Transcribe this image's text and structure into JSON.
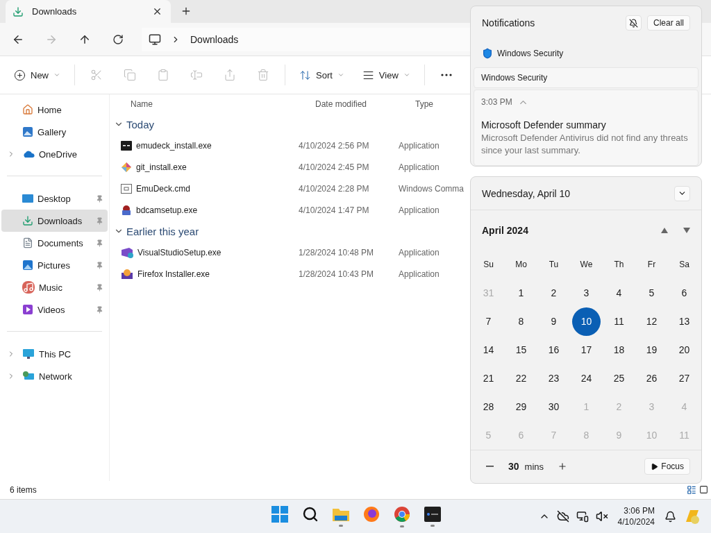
{
  "tab": {
    "title": "Downloads"
  },
  "address": {
    "crumb": "Downloads"
  },
  "toolbar": {
    "new_label": "New",
    "actions": [
      {
        "kind": "cut",
        "disabled": true
      },
      {
        "kind": "copy",
        "disabled": true
      },
      {
        "kind": "paste",
        "disabled": true
      },
      {
        "kind": "rename",
        "disabled": true
      },
      {
        "kind": "share",
        "disabled": true
      },
      {
        "kind": "delete",
        "disabled": true
      }
    ],
    "sort_label": "Sort",
    "view_label": "View"
  },
  "sidebar": {
    "groups": [
      [
        {
          "label": "Home",
          "kind": "home",
          "expandable": false,
          "pinned": false,
          "selected": false
        },
        {
          "label": "Gallery",
          "kind": "gallery",
          "expandable": false,
          "pinned": false,
          "selected": false
        },
        {
          "label": "OneDrive",
          "kind": "cloud",
          "expandable": true,
          "pinned": false,
          "selected": false
        }
      ],
      [
        {
          "label": "Desktop",
          "kind": "desktop",
          "expandable": false,
          "pinned": true,
          "selected": false
        },
        {
          "label": "Downloads",
          "kind": "download",
          "expandable": false,
          "pinned": true,
          "selected": true
        },
        {
          "label": "Documents",
          "kind": "document",
          "expandable": false,
          "pinned": true,
          "selected": false
        },
        {
          "label": "Pictures",
          "kind": "pictures",
          "expandable": false,
          "pinned": true,
          "selected": false
        },
        {
          "label": "Music",
          "kind": "music",
          "expandable": false,
          "pinned": true,
          "selected": false
        },
        {
          "label": "Videos",
          "kind": "videos",
          "expandable": false,
          "pinned": true,
          "selected": false
        }
      ],
      [
        {
          "label": "This PC",
          "kind": "pc",
          "expandable": true,
          "pinned": false,
          "selected": false
        },
        {
          "label": "Network",
          "kind": "network",
          "expandable": true,
          "pinned": false,
          "selected": false
        }
      ]
    ]
  },
  "columns": [
    "Name",
    "Date modified",
    "Type"
  ],
  "file_groups": [
    {
      "title": "Today",
      "expanded": true,
      "rows": [
        {
          "name": "emudeck_install.exe",
          "date": "4/10/2024 2:56 PM",
          "type": "Application",
          "kind": "terminal"
        },
        {
          "name": "git_install.exe",
          "date": "4/10/2024 2:45 PM",
          "type": "Application",
          "kind": "git"
        },
        {
          "name": "EmuDeck.cmd",
          "date": "4/10/2024 2:28 PM",
          "type": "Windows Comma",
          "kind": "cmd"
        },
        {
          "name": "bdcamsetup.exe",
          "date": "4/10/2024 1:47 PM",
          "type": "Application",
          "kind": "camera"
        }
      ]
    },
    {
      "title": "Earlier this year",
      "expanded": true,
      "rows": [
        {
          "name": "VisualStudioSetup.exe",
          "date": "1/28/2024 10:48 PM",
          "type": "Application",
          "kind": "vs"
        },
        {
          "name": "Firefox Installer.exe",
          "date": "1/28/2024 10:43 PM",
          "type": "Application",
          "kind": "box"
        }
      ]
    }
  ],
  "status_bar": {
    "count": "6 items"
  },
  "notifications": {
    "title": "Notifications",
    "clear_label": "Clear all",
    "app": "Windows Security",
    "card": {
      "header": "Windows Security",
      "time": "3:03 PM",
      "expanded": true,
      "title": "Microsoft Defender summary",
      "body": "Microsoft Defender Antivirus did not find any threats since your last summary."
    }
  },
  "calendar": {
    "date_header": "Wednesday, April 10",
    "month": "April 2024",
    "weekdays": [
      "Su",
      "Mo",
      "Tu",
      "We",
      "Th",
      "Fr",
      "Sa"
    ],
    "weeks": [
      [
        {
          "day": "31",
          "in_month": false,
          "selected": false
        },
        {
          "day": "1",
          "in_month": true,
          "selected": false
        },
        {
          "day": "2",
          "in_month": true,
          "selected": false
        },
        {
          "day": "3",
          "in_month": true,
          "selected": false
        },
        {
          "day": "4",
          "in_month": true,
          "selected": false
        },
        {
          "day": "5",
          "in_month": true,
          "selected": false
        },
        {
          "day": "6",
          "in_month": true,
          "selected": false
        }
      ],
      [
        {
          "day": "7",
          "in_month": true,
          "selected": false
        },
        {
          "day": "8",
          "in_month": true,
          "selected": false
        },
        {
          "day": "9",
          "in_month": true,
          "selected": false
        },
        {
          "day": "10",
          "in_month": true,
          "selected": true
        },
        {
          "day": "11",
          "in_month": true,
          "selected": false
        },
        {
          "day": "12",
          "in_month": true,
          "selected": false
        },
        {
          "day": "13",
          "in_month": true,
          "selected": false
        }
      ],
      [
        {
          "day": "14",
          "in_month": true,
          "selected": false
        },
        {
          "day": "15",
          "in_month": true,
          "selected": false
        },
        {
          "day": "16",
          "in_month": true,
          "selected": false
        },
        {
          "day": "17",
          "in_month": true,
          "selected": false
        },
        {
          "day": "18",
          "in_month": true,
          "selected": false
        },
        {
          "day": "19",
          "in_month": true,
          "selected": false
        },
        {
          "day": "20",
          "in_month": true,
          "selected": false
        }
      ],
      [
        {
          "day": "21",
          "in_month": true,
          "selected": false
        },
        {
          "day": "22",
          "in_month": true,
          "selected": false
        },
        {
          "day": "23",
          "in_month": true,
          "selected": false
        },
        {
          "day": "24",
          "in_month": true,
          "selected": false
        },
        {
          "day": "25",
          "in_month": true,
          "selected": false
        },
        {
          "day": "26",
          "in_month": true,
          "selected": false
        },
        {
          "day": "27",
          "in_month": true,
          "selected": false
        }
      ],
      [
        {
          "day": "28",
          "in_month": true,
          "selected": false
        },
        {
          "day": "29",
          "in_month": true,
          "selected": false
        },
        {
          "day": "30",
          "in_month": true,
          "selected": false
        },
        {
          "day": "1",
          "in_month": false,
          "selected": false
        },
        {
          "day": "2",
          "in_month": false,
          "selected": false
        },
        {
          "day": "3",
          "in_month": false,
          "selected": false
        },
        {
          "day": "4",
          "in_month": false,
          "selected": false
        }
      ],
      [
        {
          "day": "5",
          "in_month": false,
          "selected": false
        },
        {
          "day": "6",
          "in_month": false,
          "selected": false
        },
        {
          "day": "7",
          "in_month": false,
          "selected": false
        },
        {
          "day": "8",
          "in_month": false,
          "selected": false
        },
        {
          "day": "9",
          "in_month": false,
          "selected": false
        },
        {
          "day": "10",
          "in_month": false,
          "selected": false
        },
        {
          "day": "11",
          "in_month": false,
          "selected": false
        }
      ]
    ],
    "focus": {
      "minutes": "30",
      "unit": "mins",
      "button": "Focus"
    }
  },
  "taskbar": {
    "apps": [
      {
        "kind": "start",
        "running": false
      },
      {
        "kind": "search",
        "running": false
      },
      {
        "kind": "folder",
        "running": true
      },
      {
        "kind": "fox",
        "running": false
      },
      {
        "kind": "chrome",
        "running": true
      },
      {
        "kind": "terminal",
        "running": true
      }
    ],
    "time": "3:06 PM",
    "date": "4/10/2024"
  }
}
